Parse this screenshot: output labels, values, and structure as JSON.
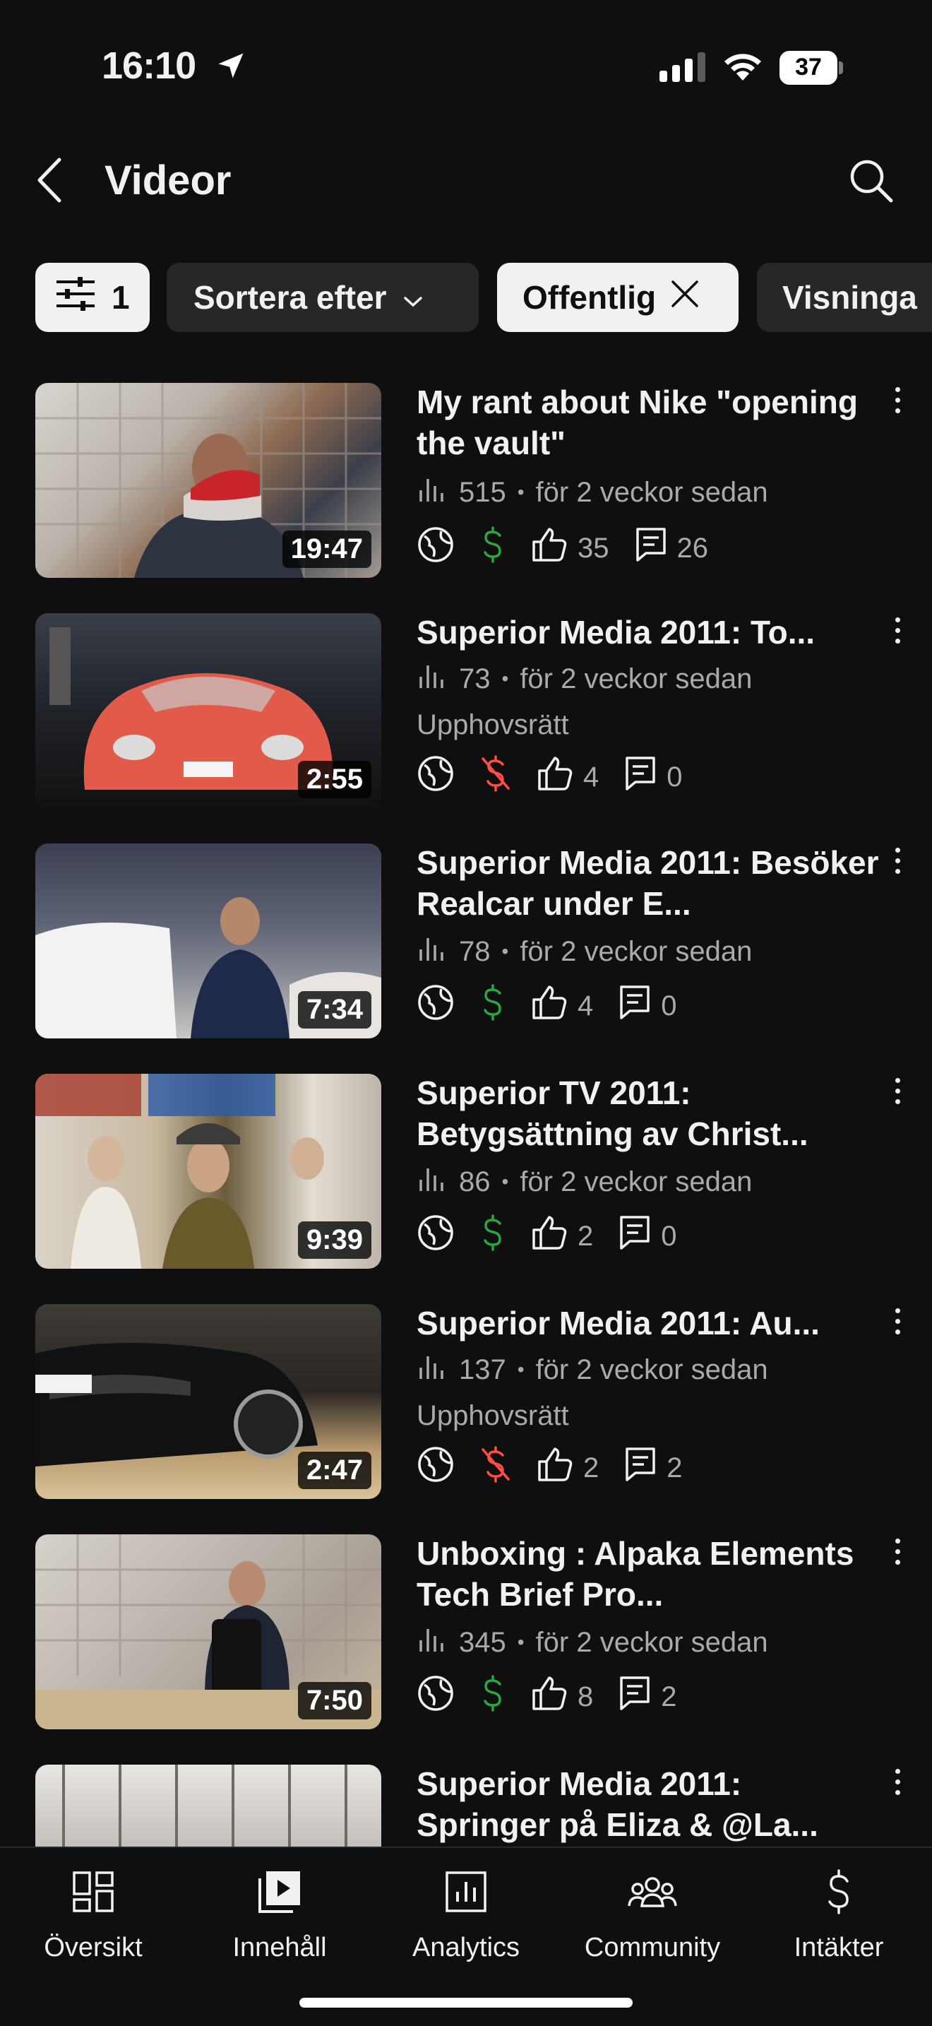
{
  "status": {
    "time": "16:10",
    "battery": "37"
  },
  "header": {
    "title": "Videor"
  },
  "chips": {
    "filter_count": "1",
    "sort_label": "Sortera efter",
    "public_label": "Offentlig",
    "views_label": "Visninga"
  },
  "videos": [
    {
      "title": "My rant about Nike \"opening the vault\"",
      "duration": "19:47",
      "views": "515",
      "age": "för 2 veckor sedan",
      "copyright": "",
      "monetized": true,
      "likes": "35",
      "comments": "26"
    },
    {
      "title": "Superior Media 2011: To...",
      "duration": "2:55",
      "views": "73",
      "age": "för 2 veckor sedan",
      "copyright": "Upphovsrätt",
      "monetized": false,
      "likes": "4",
      "comments": "0"
    },
    {
      "title": "Superior Media 2011: Besöker Realcar under E...",
      "duration": "7:34",
      "views": "78",
      "age": "för 2 veckor sedan",
      "copyright": "",
      "monetized": true,
      "likes": "4",
      "comments": "0"
    },
    {
      "title": "Superior TV 2011: Betygsättning av Christ...",
      "duration": "9:39",
      "views": "86",
      "age": "för 2 veckor sedan",
      "copyright": "",
      "monetized": true,
      "likes": "2",
      "comments": "0"
    },
    {
      "title": "Superior Media 2011: Au...",
      "duration": "2:47",
      "views": "137",
      "age": "för 2 veckor sedan",
      "copyright": "Upphovsrätt",
      "monetized": false,
      "likes": "2",
      "comments": "2"
    },
    {
      "title": "Unboxing : Alpaka Elements Tech Brief Pro...",
      "duration": "7:50",
      "views": "345",
      "age": "för 2 veckor sedan",
      "copyright": "",
      "monetized": true,
      "likes": "8",
      "comments": "2"
    },
    {
      "title": "Superior Media 2011: Springer på Eliza & @La...",
      "duration": "",
      "views": "",
      "age": "",
      "copyright": "",
      "monetized": true,
      "likes": "",
      "comments": ""
    }
  ],
  "nav": [
    {
      "label": "Översikt",
      "icon": "dashboard-icon"
    },
    {
      "label": "Innehåll",
      "icon": "content-icon"
    },
    {
      "label": "Analytics",
      "icon": "analytics-icon"
    },
    {
      "label": "Community",
      "icon": "community-icon"
    },
    {
      "label": "Intäkter",
      "icon": "earn-icon"
    }
  ],
  "colors": {
    "background": "#0f0f0f",
    "chip": "#272727",
    "monetized": "#2ba640",
    "demonetized": "#ff4e45",
    "secondary_text": "#aaaaaa"
  }
}
